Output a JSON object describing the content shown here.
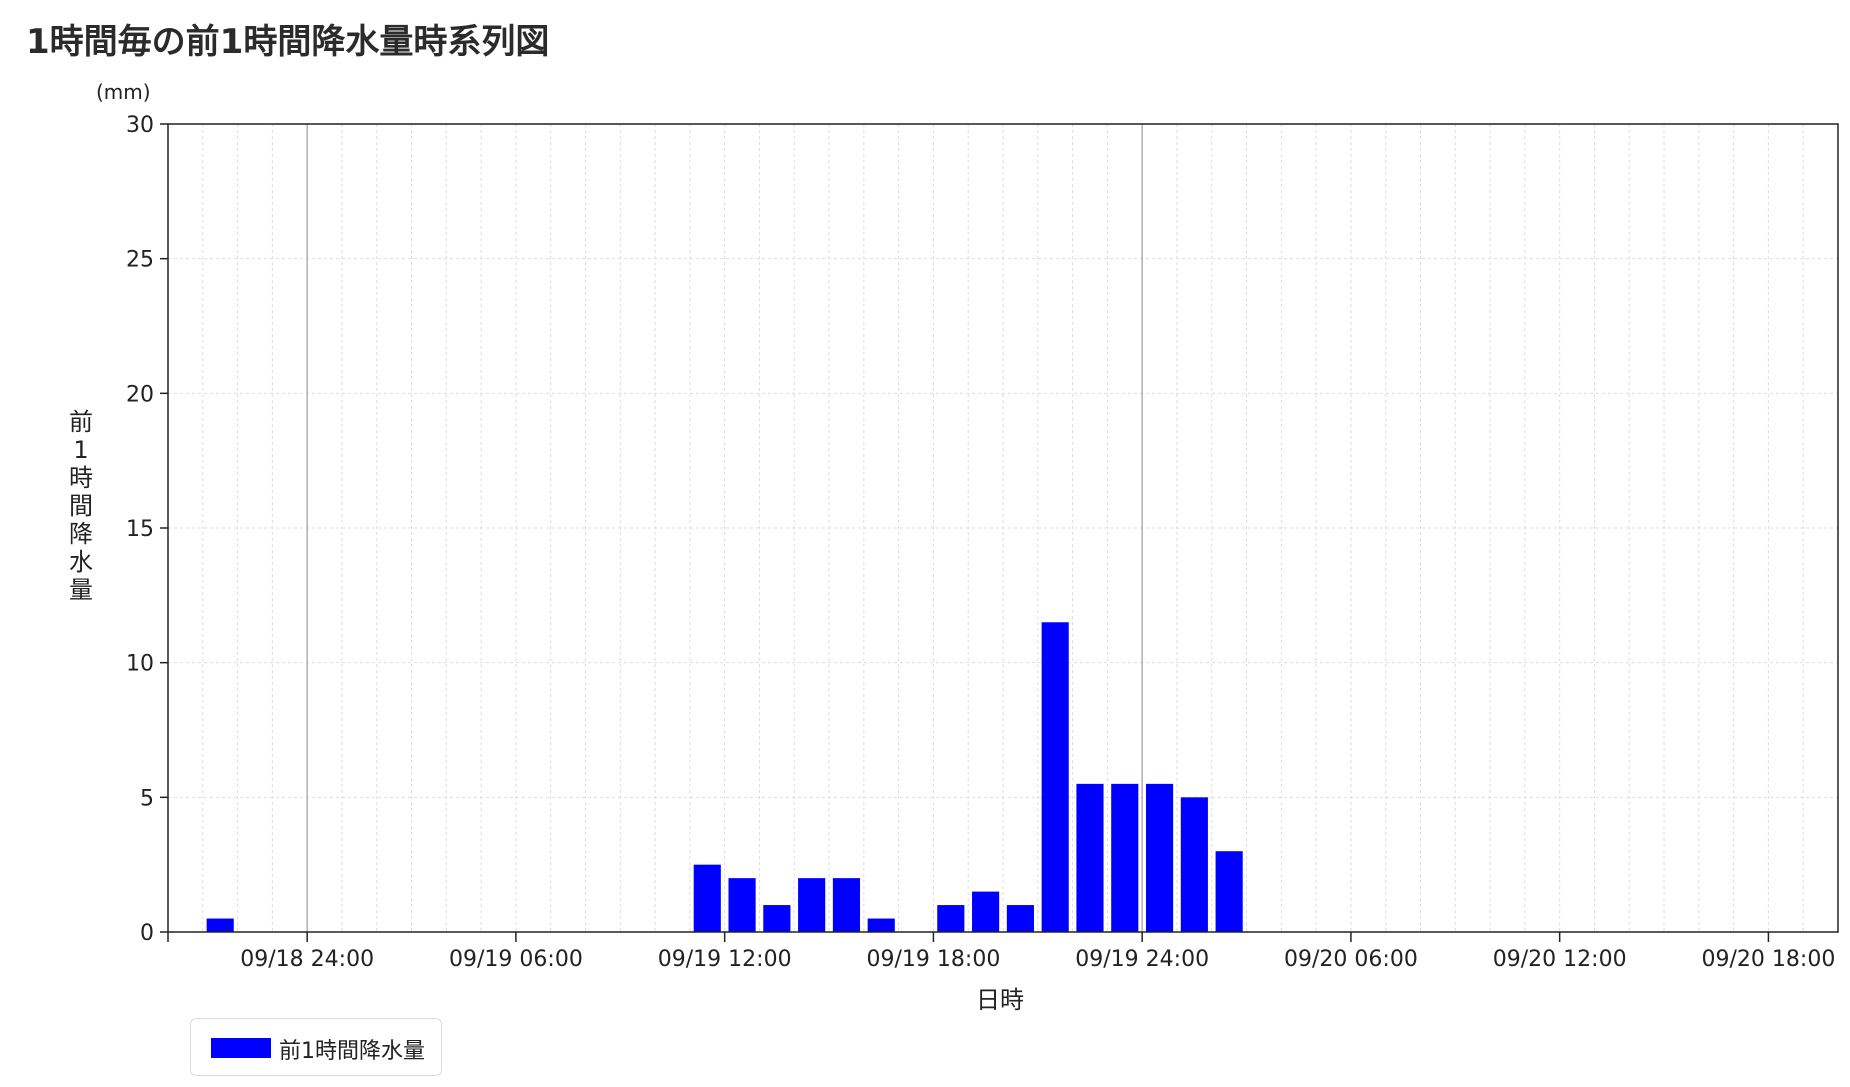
{
  "page": {
    "title": "1時間毎の前1時間降水量時系列図"
  },
  "chart_data": {
    "type": "bar",
    "title": "1時間毎の前1時間降水量時系列図",
    "unit": "(mm)",
    "xlabel": "日時",
    "ylabel": "前1時間降水量",
    "ylim": [
      0,
      30
    ],
    "y_ticks": [
      0,
      5,
      10,
      15,
      20,
      25,
      30
    ],
    "x_range": [
      "2023-09-18 20:00",
      "2023-09-20 20:00"
    ],
    "x_ticks": [
      "09/18 24:00",
      "09/19 06:00",
      "09/19 12:00",
      "09/19 18:00",
      "09/19 24:00",
      "09/20 06:00",
      "09/20 12:00",
      "09/20 18:00"
    ],
    "grid": true,
    "legend_position": "bottom-left",
    "series": [
      {
        "name": "前1時間降水量",
        "color": "#0000ff",
        "x": [
          "09/18 22:00",
          "09/19 12:00",
          "09/19 13:00",
          "09/19 14:00",
          "09/19 15:00",
          "09/19 16:00",
          "09/19 17:00",
          "09/19 19:00",
          "09/19 20:00",
          "09/19 21:00",
          "09/19 22:00",
          "09/19 23:00",
          "09/19 24:00",
          "09/20 01:00",
          "09/20 02:00",
          "09/20 03:00"
        ],
        "values": [
          0.5,
          2.5,
          2.0,
          1.0,
          2.0,
          2.0,
          0.5,
          1.0,
          1.5,
          1.0,
          11.5,
          5.5,
          5.5,
          5.5,
          5.0,
          3.0
        ]
      }
    ]
  }
}
